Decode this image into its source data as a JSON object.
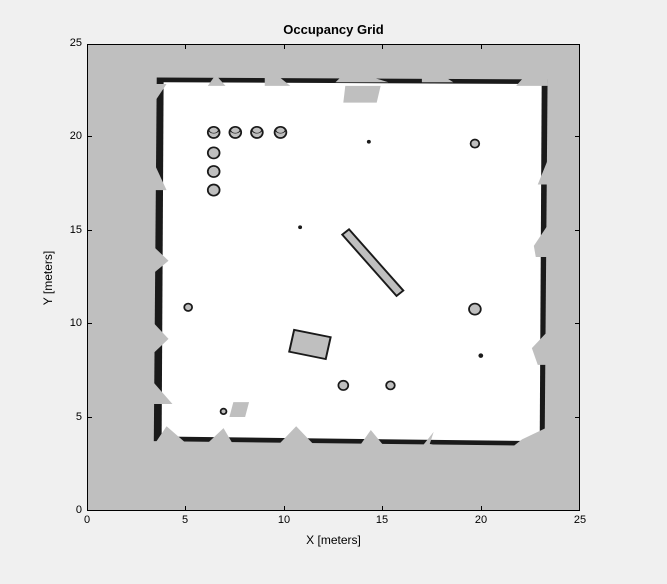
{
  "chart_data": {
    "type": "heatmap",
    "title": "Occupancy Grid",
    "xlabel": "X [meters]",
    "ylabel": "Y [meters]",
    "xlim": [
      0,
      25
    ],
    "ylim": [
      0,
      25
    ],
    "xticks": [
      0,
      5,
      10,
      15,
      20,
      25
    ],
    "yticks": [
      0,
      5,
      10,
      15,
      20,
      25
    ],
    "data_range_x": [
      0,
      25
    ],
    "data_range_y": [
      0,
      25
    ],
    "inner_room_bounds": {
      "xmin": 3.5,
      "xmax": 23.2,
      "ymin": 3.5,
      "ymax": 23.2
    },
    "obstacles": {
      "circles": [
        {
          "cx": 6.4,
          "cy": 20.3,
          "r": 0.3
        },
        {
          "cx": 7.5,
          "cy": 20.3,
          "r": 0.3
        },
        {
          "cx": 8.6,
          "cy": 20.3,
          "r": 0.3
        },
        {
          "cx": 9.8,
          "cy": 20.3,
          "r": 0.3
        },
        {
          "cx": 6.4,
          "cy": 19.2,
          "r": 0.3
        },
        {
          "cx": 6.4,
          "cy": 18.2,
          "r": 0.3
        },
        {
          "cx": 6.4,
          "cy": 17.2,
          "r": 0.3
        },
        {
          "cx": 14.3,
          "cy": 19.8,
          "r": 0.1
        },
        {
          "cx": 19.7,
          "cy": 19.7,
          "r": 0.22
        },
        {
          "cx": 10.8,
          "cy": 15.2,
          "r": 0.1
        },
        {
          "cx": 5.1,
          "cy": 10.9,
          "r": 0.2
        },
        {
          "cx": 19.7,
          "cy": 10.8,
          "r": 0.3
        },
        {
          "cx": 20.0,
          "cy": 8.3,
          "r": 0.12
        },
        {
          "cx": 13.0,
          "cy": 6.7,
          "r": 0.25
        },
        {
          "cx": 15.4,
          "cy": 6.7,
          "r": 0.22
        },
        {
          "cx": 6.9,
          "cy": 5.3,
          "r": 0.15
        }
      ],
      "rectangles": [
        {
          "type": "rotated",
          "cx": 14.5,
          "cy": 13.3,
          "w": 0.45,
          "h": 4.3,
          "angle_deg": 40
        },
        {
          "type": "rotated",
          "cx": 11.3,
          "cy": 8.9,
          "w": 1.9,
          "h": 1.2,
          "angle_deg": -12
        }
      ]
    },
    "colors": {
      "unknown": "#bfbfbf",
      "free": "#ffffff",
      "occupied": "#222222"
    }
  }
}
